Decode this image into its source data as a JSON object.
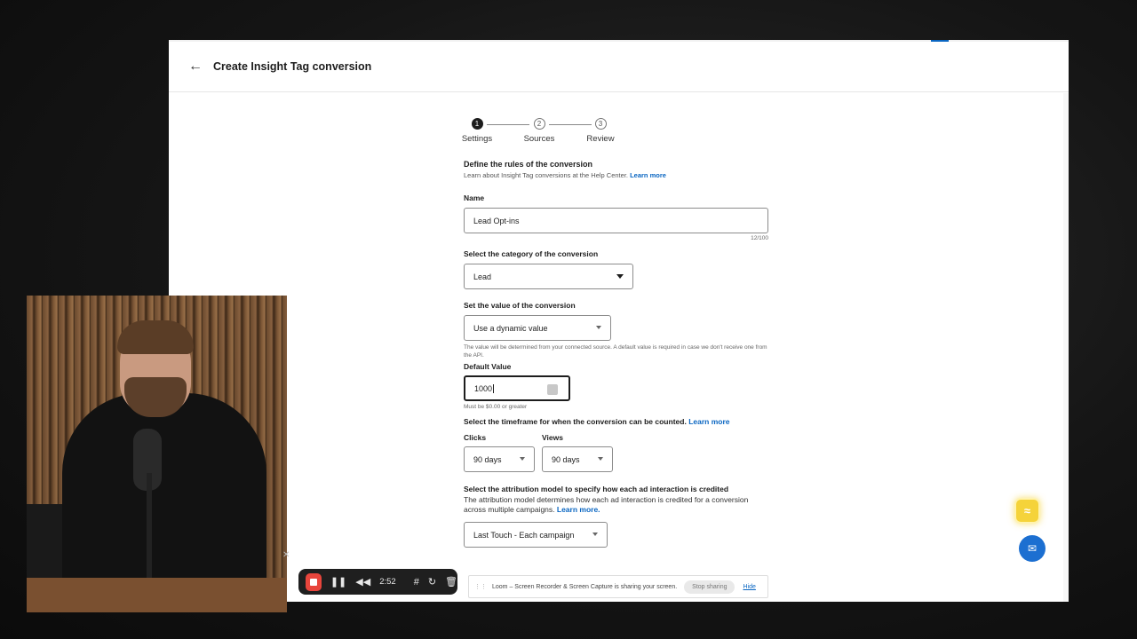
{
  "header": {
    "back_icon": "arrow-left-icon",
    "title": "Create Insight Tag conversion"
  },
  "stepper": {
    "steps": [
      {
        "num": "1",
        "label": "Settings",
        "active": true
      },
      {
        "num": "2",
        "label": "Sources",
        "active": false
      },
      {
        "num": "3",
        "label": "Review",
        "active": false
      }
    ]
  },
  "rules": {
    "title": "Define the rules of the conversion",
    "subtitle": "Learn about Insight Tag conversions at the Help Center.",
    "learn_more": "Learn more"
  },
  "name_field": {
    "label": "Name",
    "value": "Lead Opt-ins",
    "counter": "12/100"
  },
  "category": {
    "label": "Select the category of the conversion",
    "value": "Lead"
  },
  "value_section": {
    "label": "Set the value of the conversion",
    "value": "Use a dynamic value",
    "helper": "The value will be determined from your connected source. A default value is required in case we don't receive one from the API."
  },
  "default_value": {
    "label": "Default Value",
    "value": "1000",
    "helper": "Must be $0.00 or greater"
  },
  "timeframe": {
    "label": "Select the timeframe for when the conversion can be counted.",
    "learn_more": "Learn more",
    "clicks_label": "Clicks",
    "clicks_value": "90 days",
    "views_label": "Views",
    "views_value": "90 days"
  },
  "attribution": {
    "label": "Select the attribution model to specify how each ad interaction is credited",
    "description": "The attribution model determines how each ad interaction is credited for a conversion across multiple campaigns.",
    "learn_more": "Learn more.",
    "value": "Last Touch - Each campaign"
  },
  "recorder": {
    "time": "2:52"
  },
  "loom": {
    "message": "Loom – Screen Recorder & Screen Capture is sharing your screen.",
    "stop_label": "Stop sharing",
    "hide_label": "Hide"
  },
  "colors": {
    "accent": "#0a66c2",
    "record": "#e8453c",
    "helper_yellow": "#f5d33a",
    "chat_blue": "#1c6fd1"
  }
}
